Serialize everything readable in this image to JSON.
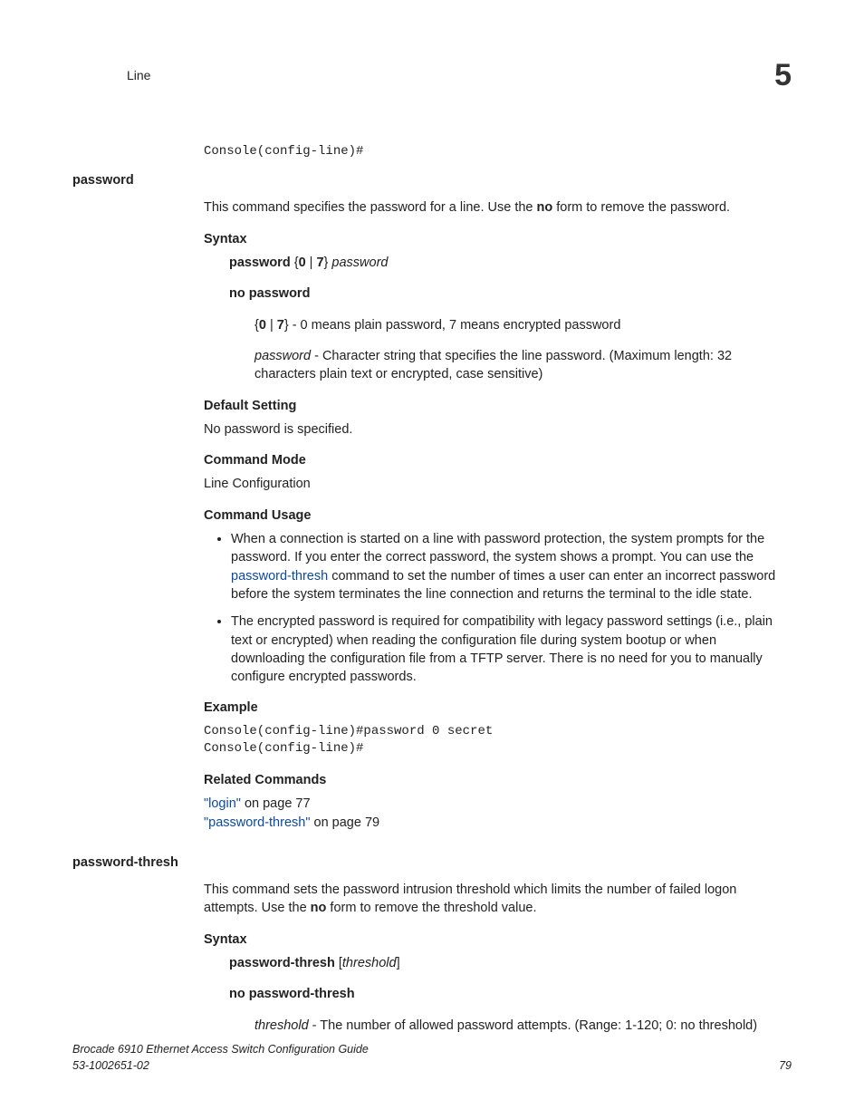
{
  "running_head": {
    "title": "Line",
    "chapter_num": "5"
  },
  "code_top": "Console(config-line)#",
  "sec_password": {
    "heading": "password",
    "intro_a": "This command specifies the password for a line. Use the ",
    "intro_b_bold": "no",
    "intro_c": " form to remove the password.",
    "syntax_label": "Syntax",
    "syntax_line1_a": "password",
    "syntax_line1_b": " {",
    "syntax_line1_c": "0",
    "syntax_line1_d": " | ",
    "syntax_line1_e": "7",
    "syntax_line1_f": "} ",
    "syntax_line1_g_it": "password",
    "syntax_line2_bold": "no password",
    "param07_a": "{",
    "param07_b": "0",
    "param07_c": " | ",
    "param07_d": "7",
    "param07_e": "}",
    "param07_f": " - 0 means plain password, 7 means encrypted password",
    "param_pw_a_it": "password",
    "param_pw_b": " - Character string that specifies the line password. (Maximum length: 32 characters plain text or encrypted, case sensitive)",
    "default_label": "Default Setting",
    "default_text": "No password is specified.",
    "mode_label": "Command Mode",
    "mode_text": "Line Configuration",
    "usage_label": "Command Usage",
    "usage_b1_a": "When a connection is started on a line with password protection, the system prompts for the password. If you enter the correct password, the system shows a prompt. You can use the ",
    "usage_b1_link": "password-thresh",
    "usage_b1_b": " command to set the number of times a user can enter an incorrect password before the system terminates the line connection and returns the terminal to the idle state.",
    "usage_b2": "The encrypted password is required for compatibility with legacy password settings (i.e., plain text or encrypted) when reading the configuration file during system bootup or when downloading the configuration file from a TFTP server. There is no need for you to manually configure encrypted passwords.",
    "example_label": "Example",
    "example_code": "Console(config-line)#password 0 secret\nConsole(config-line)#",
    "related_label": "Related Commands",
    "related1_link": "\"login\"",
    "related1_rest": " on page 77",
    "related2_link": "\"password-thresh\"",
    "related2_rest": " on page 79"
  },
  "sec_thresh": {
    "heading": "password-thresh",
    "intro_a": "This command sets the password intrusion threshold which limits the number of failed logon attempts. Use the ",
    "intro_b_bold": "no",
    "intro_c": " form to remove the threshold value.",
    "syntax_label": "Syntax",
    "syntax_line1_a": "password-thresh",
    "syntax_line1_b": " [",
    "syntax_line1_c_it": "threshold",
    "syntax_line1_d": "]",
    "syntax_line2_bold": "no password-thresh",
    "param_a_it": "threshold",
    "param_b": " - The number of allowed password attempts. (Range: 1-120; 0: no threshold)"
  },
  "footer": {
    "book": "Brocade 6910 Ethernet Access Switch Configuration Guide",
    "docnum": "53-1002651-02",
    "page": "79"
  }
}
